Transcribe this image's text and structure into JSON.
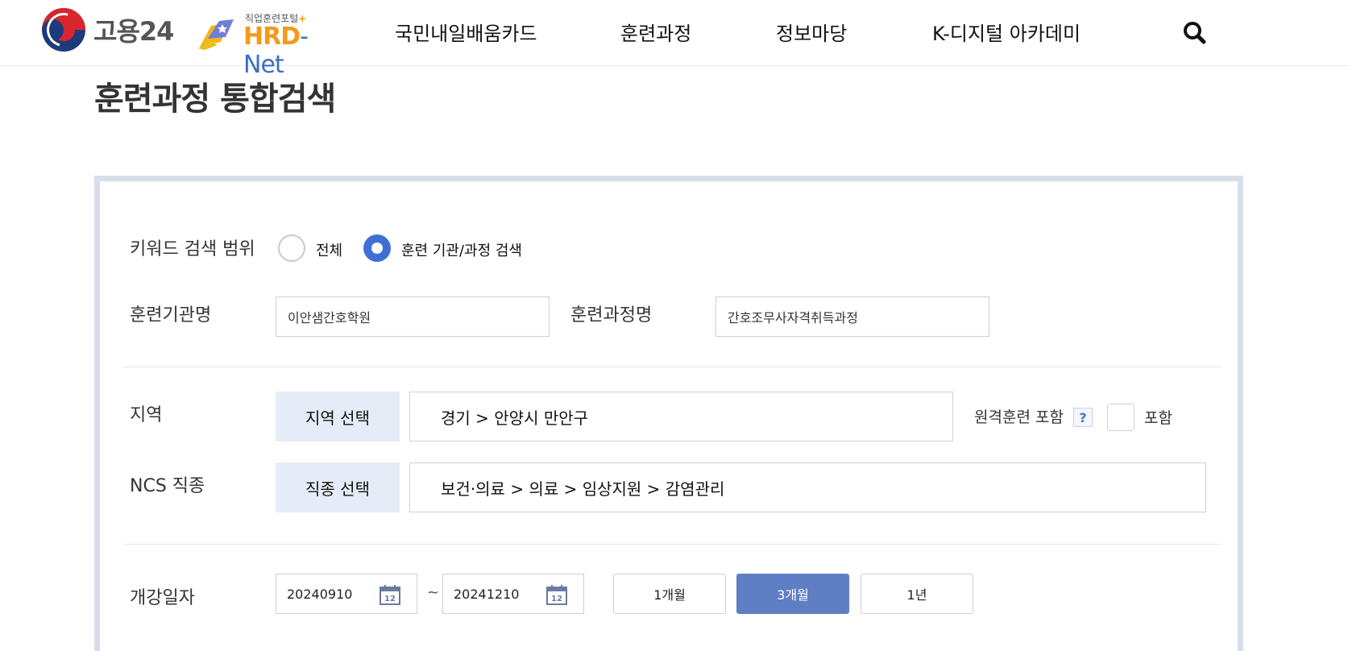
{
  "header": {
    "logo_text": "고용24",
    "hrd_sub": "직업훈련포털",
    "hrd_main": "HRD",
    "hrd_net": "-Net",
    "nav": [
      "국민내일배움카드",
      "훈련과정",
      "정보마당",
      "K-디지털 아카데미"
    ]
  },
  "page_title": "훈련과정 통합검색",
  "search_scope": {
    "label": "키워드 검색 범위",
    "options": [
      "전체",
      "훈련 기관/과정 검색"
    ],
    "selected_index": 1
  },
  "institution": {
    "label": "훈련기관명",
    "value": "이안샘간호학원"
  },
  "course": {
    "label": "훈련과정명",
    "value": "간호조무사자격취득과정"
  },
  "region": {
    "label": "지역",
    "button": "지역 선택",
    "value": "경기 > 안양시 만안구",
    "remote_label": "원격훈련 포함",
    "help": "?",
    "include_label": "포함"
  },
  "ncs": {
    "label": "NCS 직종",
    "button": "직종 선택",
    "value": "보건·의료 > 의료 > 임상지원 > 감염관리"
  },
  "dates": {
    "label": "개강일자",
    "start": "20240910",
    "end": "20241210",
    "separator": "~",
    "calendar_day": "12",
    "periods": [
      "1개월",
      "3개월",
      "1년"
    ],
    "active_period_index": 1
  },
  "colors": {
    "accent": "#3f6fd6",
    "active_button": "#5f7fc4",
    "select_button_bg": "#e5ecf7",
    "panel_border": "#d7dde9"
  }
}
